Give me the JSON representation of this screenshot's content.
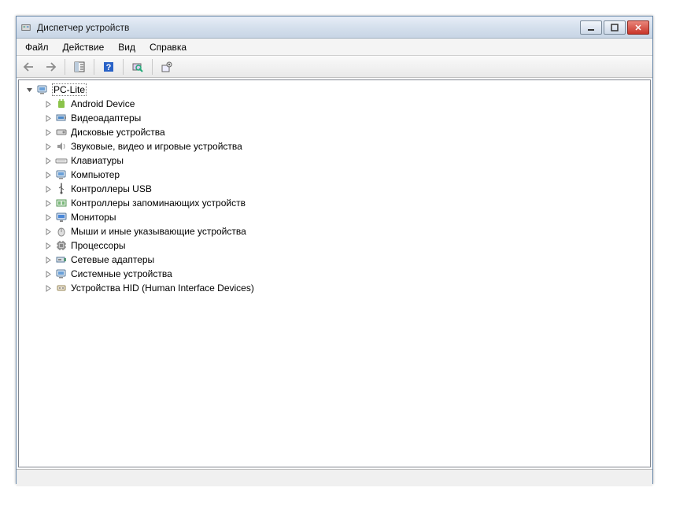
{
  "window": {
    "title": "Диспетчер устройств"
  },
  "menu": {
    "file": "Файл",
    "action": "Действие",
    "view": "Вид",
    "help": "Справка"
  },
  "tree": {
    "root": "PC-Lite",
    "items": [
      {
        "label": "Android Device"
      },
      {
        "label": "Видеоадаптеры"
      },
      {
        "label": "Дисковые устройства"
      },
      {
        "label": "Звуковые, видео и игровые устройства"
      },
      {
        "label": "Клавиатуры"
      },
      {
        "label": "Компьютер"
      },
      {
        "label": "Контроллеры USB"
      },
      {
        "label": "Контроллеры запоминающих устройств"
      },
      {
        "label": "Мониторы"
      },
      {
        "label": "Мыши и иные указывающие устройства"
      },
      {
        "label": "Процессоры"
      },
      {
        "label": "Сетевые адаптеры"
      },
      {
        "label": "Системные устройства"
      },
      {
        "label": "Устройства HID (Human Interface Devices)"
      }
    ]
  }
}
